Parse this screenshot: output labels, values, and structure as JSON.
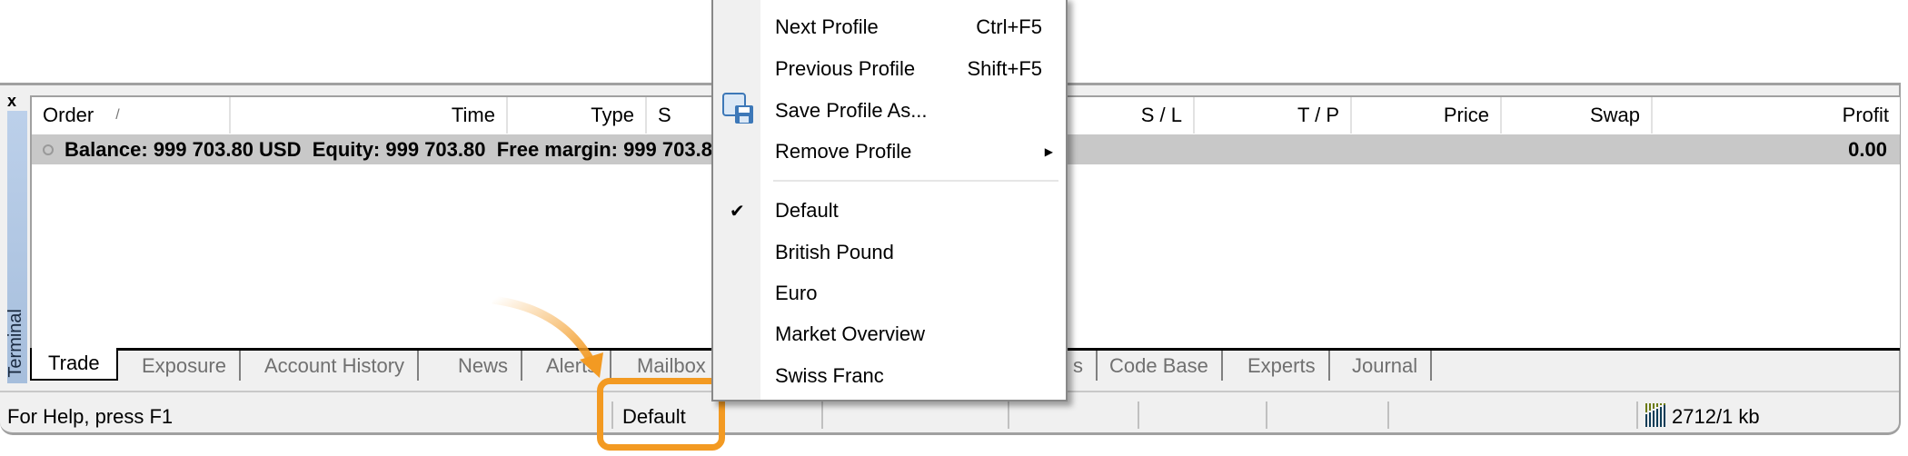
{
  "terminal": {
    "close_label": "x",
    "side_label": "Terminal",
    "columns": [
      "Order",
      "Time",
      "Type",
      "S",
      "S / L",
      "T / P",
      "Price",
      "Swap",
      "Profit"
    ],
    "sort_indicator": "/",
    "summary": {
      "text": "Balance: 999 703.80 USD  Equity: 999 703.80  Free margin: 999 703.80",
      "profit": "0.00"
    },
    "tabs": [
      "Trade",
      "Exposure",
      "Account History",
      "News",
      "Alerts",
      "Mailbox",
      "s",
      "Code Base",
      "Experts",
      "Journal"
    ],
    "active_tab": "Trade"
  },
  "status": {
    "help": "For Help, press F1",
    "profile": "Default",
    "traffic": "2712/1 kb"
  },
  "menu": {
    "items": [
      {
        "label": "Next Profile",
        "shortcut": "Ctrl+F5"
      },
      {
        "label": "Previous Profile",
        "shortcut": "Shift+F5"
      },
      {
        "label": "Save Profile As...",
        "icon": "save-profile-icon"
      },
      {
        "label": "Remove Profile",
        "submenu": true
      },
      {
        "label": "Default",
        "checked": true
      },
      {
        "label": "British Pound"
      },
      {
        "label": "Euro"
      },
      {
        "label": "Market Overview"
      },
      {
        "label": "Swiss Franc"
      }
    ]
  },
  "colors": {
    "highlight": "#f39a22",
    "side": "#b0c8e4"
  }
}
